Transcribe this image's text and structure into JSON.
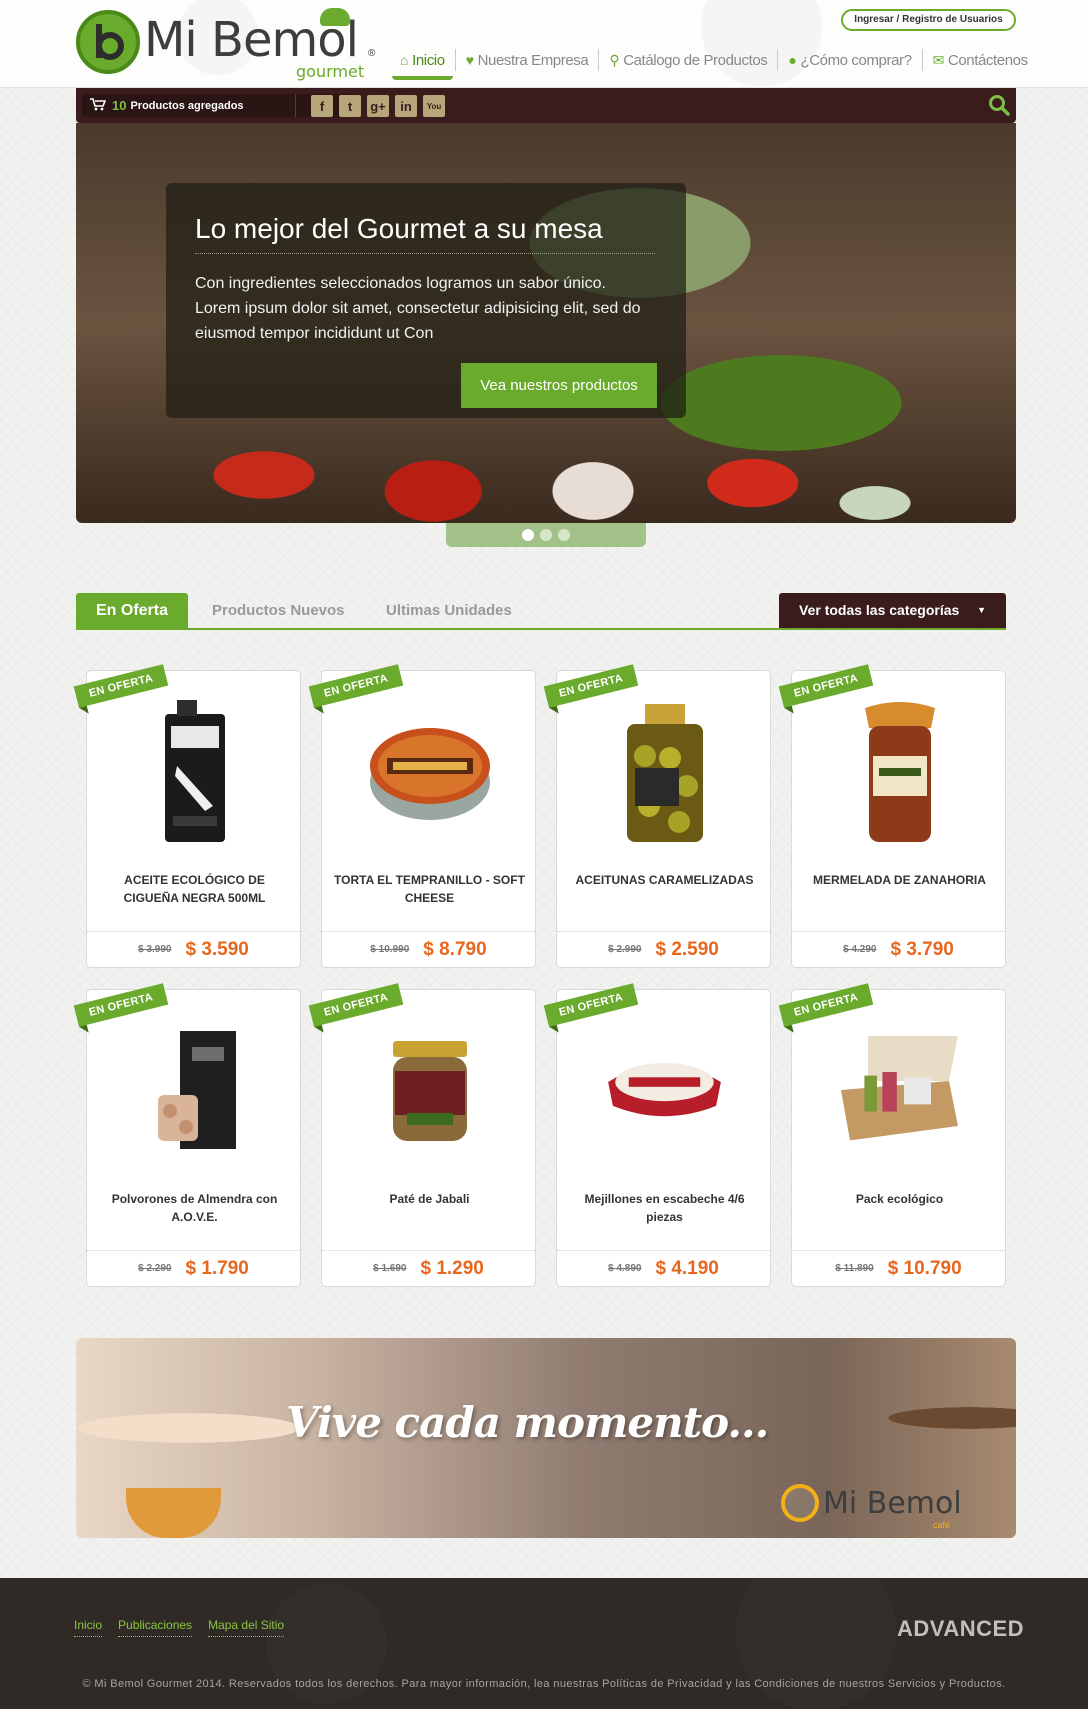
{
  "header": {
    "brand": "Mi Bemol",
    "brand_sub": "gourmet",
    "brand_reg": "®",
    "login_label": "Ingresar / Registro de Usuarios",
    "nav": [
      {
        "label": "Inicio",
        "icon": "home-icon"
      },
      {
        "label": "Nuestra Empresa",
        "icon": "heart-icon"
      },
      {
        "label": "Catálogo de Productos",
        "icon": "search-icon"
      },
      {
        "label": "¿Cómo comprar?",
        "icon": "lightbulb-icon"
      },
      {
        "label": "Contáctenos",
        "icon": "envelope-icon"
      }
    ]
  },
  "toolbar": {
    "cart_count": "10",
    "cart_label": "Productos agregados",
    "social": [
      {
        "name": "facebook-icon",
        "glyph": "f"
      },
      {
        "name": "twitter-icon",
        "glyph": "t"
      },
      {
        "name": "googleplus-icon",
        "glyph": "g+"
      },
      {
        "name": "linkedin-icon",
        "glyph": "in"
      },
      {
        "name": "youtube-icon",
        "glyph": "You"
      }
    ]
  },
  "hero": {
    "title": "Lo mejor del Gourmet a su mesa",
    "text": "Con ingredientes seleccionados logramos un sabor único. Lorem ipsum dolor sit amet, consectetur adipisicing elit, sed do eiusmod tempor incididunt ut Con",
    "button": "Vea nuestros productos",
    "slides": 3,
    "active_slide": 1
  },
  "tabs": {
    "items": [
      "En Oferta",
      "Productos Nuevos",
      "Ultimas Unidades"
    ],
    "categories_button": "Ver todas las categorías"
  },
  "ribbon_label": "EN OFERTA",
  "products": [
    {
      "name": "ACEITE ECOLÓGICO DE CIGUEÑA NEGRA 500ML",
      "old": "$ 3.990",
      "price": "$ 3.590"
    },
    {
      "name": "TORTA EL TEMPRANILLO - SOFT CHEESE",
      "old": "$ 10.990",
      "price": "$ 8.790"
    },
    {
      "name": "ACEITUNAS CARAMELIZADAS",
      "old": "$ 2.990",
      "price": "$ 2.590"
    },
    {
      "name": "MERMELADA DE ZANAHORIA",
      "old": "$ 4.290",
      "price": "$ 3.790"
    },
    {
      "name": "Polvorones de Almendra con A.O.V.E.",
      "old": "$ 2.290",
      "price": "$ 1.790"
    },
    {
      "name": "Paté de Jabali",
      "old": "$ 1.690",
      "price": "$ 1.290"
    },
    {
      "name": "Mejillones en escabeche 4/6 piezas",
      "old": "$ 4.890",
      "price": "$ 4.190"
    },
    {
      "name": "Pack ecológico",
      "old": "$ 11.890",
      "price": "$ 10.790"
    }
  ],
  "banner": {
    "text": "Vive cada momento...",
    "logo": "Mi Bemol",
    "logo_sub": "café"
  },
  "footer": {
    "links": [
      "Inicio",
      "Publicaciones",
      "Mapa del Sitio"
    ],
    "credit": "ADVANCED",
    "copyright": "© Mi Bemol Gourmet 2014. Reservados todos los derechos. Para mayor información, lea nuestras Políticas de Privacidad y las Condiciones de nuestros Servicios y Productos."
  },
  "colors": {
    "accent": "#6aaa2c",
    "dark_brown": "#3a1c1c",
    "price_orange": "#e8671e",
    "footer_bg": "#302a26"
  }
}
